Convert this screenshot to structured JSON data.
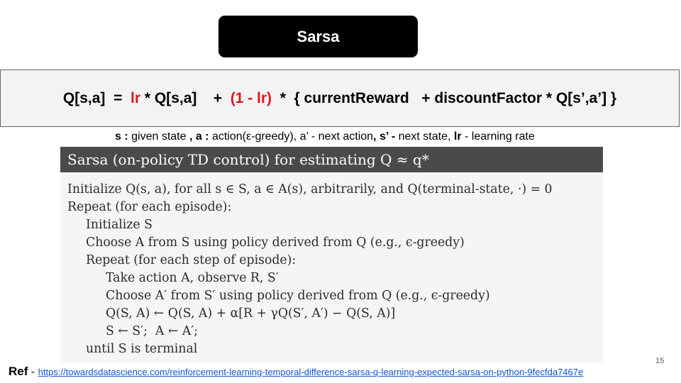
{
  "slide": {
    "title": "Sarsa",
    "page_number": "15"
  },
  "formula": {
    "part1": "Q[s,a]  =  ",
    "lr1": "lr",
    "part2": " * Q[s,a]    +  ",
    "lr_term": "(1 - lr)",
    "part3": "  *  { currentReward   + discountFactor * Q[s’,a’] }"
  },
  "legend": {
    "s_label": "s :",
    "s_text": " given state ",
    "a_label": ", a :",
    "a_text": " action(ε-greedy), a’ - next action",
    "sp_label": ", s’ -",
    "sp_text": " next state, ",
    "lr_label": "lr",
    "lr_text": " - learning rate"
  },
  "algorithm": {
    "header": "Sarsa (on-policy TD control) for estimating Q ≈ q*",
    "lines": [
      {
        "indent": 0,
        "text": "Initialize Q(s, a), for all s ∈ S, a ∈ A(s), arbitrarily, and Q(terminal-state, ·) = 0"
      },
      {
        "indent": 0,
        "text": "Repeat (for each episode):"
      },
      {
        "indent": 1,
        "text": "Initialize S"
      },
      {
        "indent": 1,
        "text": "Choose A from S using policy derived from Q (e.g., ϵ-greedy)"
      },
      {
        "indent": 1,
        "text": "Repeat (for each step of episode):"
      },
      {
        "indent": 2,
        "text": "Take action A, observe R, S′"
      },
      {
        "indent": 2,
        "text": "Choose A′ from S′ using policy derived from Q (e.g., ϵ-greedy)"
      },
      {
        "indent": 2,
        "text": "Q(S, A) ← Q(S, A) + α[R + γQ(S′, A′) − Q(S, A)]"
      },
      {
        "indent": 2,
        "text": "S ← S′;  A ← A′;"
      },
      {
        "indent": 1,
        "text": "until S is terminal"
      }
    ]
  },
  "reference": {
    "label": "Ref",
    "separator": " - ",
    "url": "https://towardsdatascience.com/reinforcement-learning-temporal-difference-sarsa-q-learning-expected-sarsa-on-python-9fecfda7467e"
  }
}
